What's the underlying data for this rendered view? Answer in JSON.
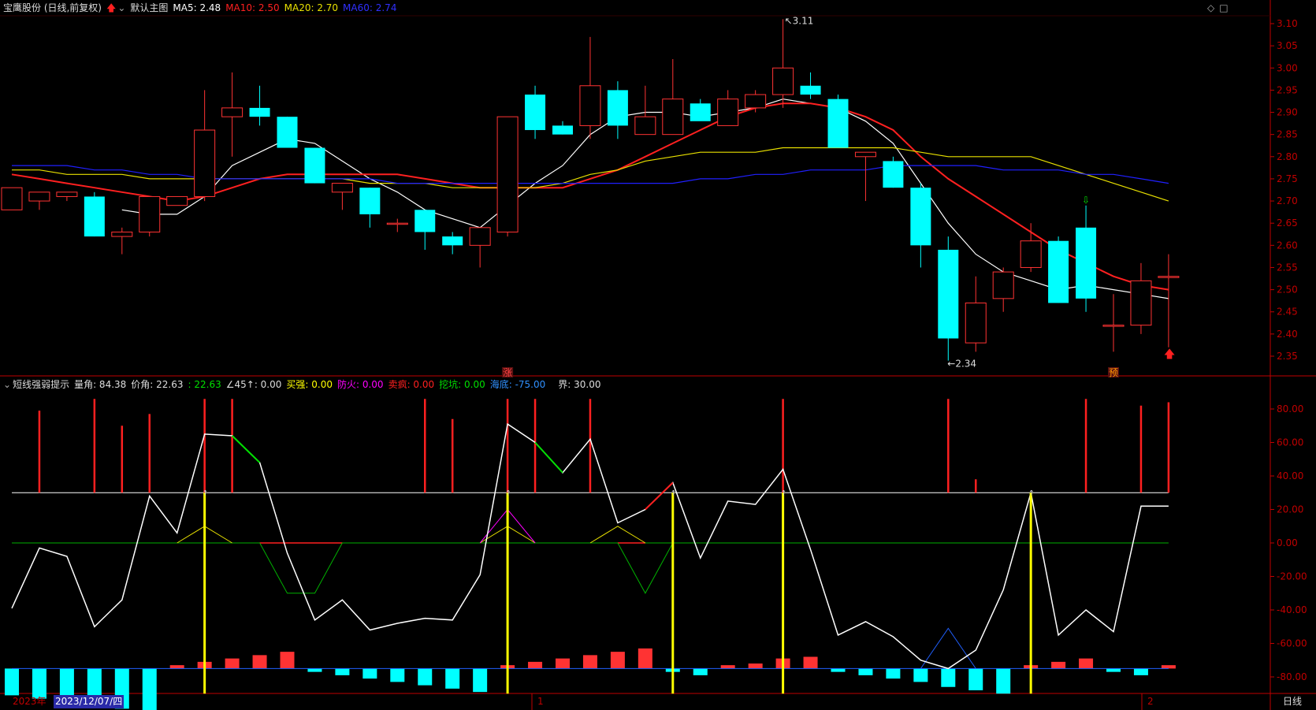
{
  "header": {
    "stock_title": "宝鹰股份 (日线,前复权)",
    "main_chart_label": "默认主图",
    "ma5_label": "MA5: 2.48",
    "ma10_label": "MA10: 2.50",
    "ma20_label": "MA20: 2.70",
    "ma60_label": "MA60: 2.74"
  },
  "indicator_header": {
    "name": "短线强弱提示",
    "vol_angle": "量角: 84.38",
    "price_angle": "价角: 22.63",
    "v1": ": 22.63",
    "v2": "∠45↑: 0.00",
    "buy_strong": "买强: 0.00",
    "fire_guard": "防火: 0.00",
    "sell_crazy": "卖疯: 0.00",
    "dig_pit": "挖坑: 0.00",
    "sea_bottom": "海底: -75.00",
    "boundary": "界: 30.00"
  },
  "footer": {
    "year_label": "2023年",
    "date_label": "2023/12/07/四",
    "month1": "1",
    "month2": "2",
    "period": "日线"
  },
  "colors": {
    "up": "#ff3333",
    "down": "#00ffff",
    "ma5": "#ffffff",
    "ma10": "#ff2020",
    "ma20": "#e8e000",
    "ma60": "#2020ff",
    "axis": "#c00000",
    "white_line": "#ffffff",
    "green": "#00b000",
    "yellow": "#ffff00",
    "magenta": "#ff00ff",
    "blue": "#2060ff"
  },
  "chart_data": [
    {
      "type": "candlestick",
      "title": "宝鹰股份 (日线,前复权)",
      "y_ticks": [
        3.1,
        3.05,
        3.0,
        2.95,
        2.9,
        2.85,
        2.8,
        2.75,
        2.7,
        2.65,
        2.6,
        2.55,
        2.5,
        2.45,
        2.4,
        2.35
      ],
      "ylim": [
        2.33,
        3.12
      ],
      "annotations": [
        {
          "text": "3.11",
          "kind": "high"
        },
        {
          "text": "2.34",
          "kind": "low"
        }
      ],
      "markers": [
        {
          "text": "涨",
          "index": 18
        },
        {
          "text": "预",
          "index": 40
        }
      ],
      "candles": [
        {
          "o": 2.68,
          "h": 2.73,
          "l": 2.68,
          "c": 2.73
        },
        {
          "o": 2.7,
          "h": 2.72,
          "l": 2.68,
          "c": 2.72
        },
        {
          "o": 2.71,
          "h": 2.72,
          "l": 2.7,
          "c": 2.72
        },
        {
          "o": 2.71,
          "h": 2.72,
          "l": 2.62,
          "c": 2.62
        },
        {
          "o": 2.62,
          "h": 2.64,
          "l": 2.58,
          "c": 2.63
        },
        {
          "o": 2.63,
          "h": 2.71,
          "l": 2.62,
          "c": 2.71
        },
        {
          "o": 2.69,
          "h": 2.71,
          "l": 2.69,
          "c": 2.71
        },
        {
          "o": 2.71,
          "h": 2.95,
          "l": 2.7,
          "c": 2.86
        },
        {
          "o": 2.89,
          "h": 2.99,
          "l": 2.8,
          "c": 2.91
        },
        {
          "o": 2.91,
          "h": 2.96,
          "l": 2.87,
          "c": 2.89
        },
        {
          "o": 2.89,
          "h": 2.89,
          "l": 2.82,
          "c": 2.82
        },
        {
          "o": 2.82,
          "h": 2.82,
          "l": 2.74,
          "c": 2.74
        },
        {
          "o": 2.72,
          "h": 2.74,
          "l": 2.68,
          "c": 2.74
        },
        {
          "o": 2.73,
          "h": 2.73,
          "l": 2.64,
          "c": 2.67
        },
        {
          "o": 2.65,
          "h": 2.66,
          "l": 2.63,
          "c": 2.65
        },
        {
          "o": 2.68,
          "h": 2.68,
          "l": 2.59,
          "c": 2.63
        },
        {
          "o": 2.62,
          "h": 2.63,
          "l": 2.58,
          "c": 2.6
        },
        {
          "o": 2.6,
          "h": 2.64,
          "l": 2.55,
          "c": 2.64
        },
        {
          "o": 2.63,
          "h": 2.89,
          "l": 2.62,
          "c": 2.89
        },
        {
          "o": 2.94,
          "h": 2.96,
          "l": 2.84,
          "c": 2.86
        },
        {
          "o": 2.87,
          "h": 2.88,
          "l": 2.85,
          "c": 2.85
        },
        {
          "o": 2.87,
          "h": 3.07,
          "l": 2.84,
          "c": 2.96
        },
        {
          "o": 2.95,
          "h": 2.97,
          "l": 2.84,
          "c": 2.87
        },
        {
          "o": 2.85,
          "h": 2.96,
          "l": 2.85,
          "c": 2.89
        },
        {
          "o": 2.85,
          "h": 3.02,
          "l": 2.85,
          "c": 2.93
        },
        {
          "o": 2.92,
          "h": 2.93,
          "l": 2.89,
          "c": 2.88
        },
        {
          "o": 2.87,
          "h": 2.95,
          "l": 2.87,
          "c": 2.93
        },
        {
          "o": 2.91,
          "h": 2.95,
          "l": 2.9,
          "c": 2.94
        },
        {
          "o": 2.94,
          "h": 3.11,
          "l": 2.91,
          "c": 3.0
        },
        {
          "o": 2.96,
          "h": 2.99,
          "l": 2.93,
          "c": 2.94
        },
        {
          "o": 2.93,
          "h": 2.94,
          "l": 2.82,
          "c": 2.82
        },
        {
          "o": 2.8,
          "h": 2.81,
          "l": 2.7,
          "c": 2.81
        },
        {
          "o": 2.79,
          "h": 2.8,
          "l": 2.73,
          "c": 2.73
        },
        {
          "o": 2.73,
          "h": 2.74,
          "l": 2.55,
          "c": 2.6
        },
        {
          "o": 2.59,
          "h": 2.62,
          "l": 2.34,
          "c": 2.39
        },
        {
          "o": 2.38,
          "h": 2.53,
          "l": 2.36,
          "c": 2.47
        },
        {
          "o": 2.48,
          "h": 2.55,
          "l": 2.45,
          "c": 2.54
        },
        {
          "o": 2.55,
          "h": 2.65,
          "l": 2.54,
          "c": 2.61
        },
        {
          "o": 2.61,
          "h": 2.62,
          "l": 2.47,
          "c": 2.47
        },
        {
          "o": 2.64,
          "h": 2.69,
          "l": 2.45,
          "c": 2.48
        },
        {
          "o": 2.42,
          "h": 2.49,
          "l": 2.36,
          "c": 2.42
        },
        {
          "o": 2.42,
          "h": 2.56,
          "l": 2.4,
          "c": 2.52
        },
        {
          "o": 2.53,
          "h": 2.58,
          "l": 2.37,
          "c": 2.53
        }
      ],
      "series": [
        {
          "name": "MA5",
          "values": [
            null,
            null,
            null,
            null,
            2.68,
            2.67,
            2.67,
            2.71,
            2.78,
            2.81,
            2.84,
            2.83,
            2.79,
            2.75,
            2.72,
            2.68,
            2.66,
            2.64,
            2.69,
            2.74,
            2.78,
            2.85,
            2.89,
            2.9,
            2.9,
            2.89,
            2.9,
            2.91,
            2.93,
            2.92,
            2.91,
            2.88,
            2.83,
            2.74,
            2.65,
            2.58,
            2.54,
            2.52,
            2.5,
            2.51,
            2.5,
            2.49,
            2.48
          ]
        },
        {
          "name": "MA10",
          "values": [
            2.76,
            2.75,
            2.74,
            2.73,
            2.72,
            2.71,
            2.7,
            2.71,
            2.73,
            2.75,
            2.76,
            2.76,
            2.76,
            2.76,
            2.76,
            2.75,
            2.74,
            2.73,
            2.73,
            2.73,
            2.73,
            2.75,
            2.77,
            2.8,
            2.83,
            2.86,
            2.89,
            2.91,
            2.92,
            2.92,
            2.91,
            2.89,
            2.86,
            2.8,
            2.75,
            2.71,
            2.67,
            2.63,
            2.59,
            2.56,
            2.53,
            2.51,
            2.5
          ]
        },
        {
          "name": "MA20",
          "values": [
            2.77,
            2.77,
            2.76,
            2.76,
            2.76,
            2.75,
            2.75,
            2.75,
            2.75,
            2.75,
            2.75,
            2.75,
            2.75,
            2.74,
            2.74,
            2.74,
            2.73,
            2.73,
            2.73,
            2.73,
            2.74,
            2.76,
            2.77,
            2.79,
            2.8,
            2.81,
            2.81,
            2.81,
            2.82,
            2.82,
            2.82,
            2.82,
            2.82,
            2.81,
            2.8,
            2.8,
            2.8,
            2.8,
            2.78,
            2.76,
            2.74,
            2.72,
            2.7
          ]
        },
        {
          "name": "MA60",
          "values": [
            2.78,
            2.78,
            2.78,
            2.77,
            2.77,
            2.76,
            2.76,
            2.75,
            2.75,
            2.75,
            2.75,
            2.75,
            2.75,
            2.75,
            2.74,
            2.74,
            2.74,
            2.74,
            2.74,
            2.74,
            2.74,
            2.74,
            2.74,
            2.74,
            2.74,
            2.75,
            2.75,
            2.76,
            2.76,
            2.77,
            2.77,
            2.77,
            2.78,
            2.78,
            2.78,
            2.78,
            2.77,
            2.77,
            2.77,
            2.76,
            2.76,
            2.75,
            2.74
          ]
        }
      ]
    },
    {
      "type": "line",
      "title": "短线强弱提示",
      "y_ticks": [
        80.0,
        60.0,
        40.0,
        20.0,
        0.0,
        -20.0,
        -40.0,
        -60.0,
        -80.0
      ],
      "ylim": [
        -100,
        90
      ],
      "boundary": 30,
      "white_line": [
        -39,
        -3,
        -8,
        -50,
        -34,
        28,
        6,
        65,
        64,
        48,
        -6,
        -46,
        -34,
        -52,
        -48,
        -45,
        -46,
        -19,
        71,
        60,
        42,
        62,
        12,
        20,
        36,
        -9,
        25,
        23,
        44,
        -4,
        -55,
        -47,
        -56,
        -70,
        -75,
        -64,
        -28,
        30,
        -55,
        -40,
        -53,
        22,
        22
      ],
      "green_segments_on_white": [
        [
          8,
          9
        ],
        [
          19,
          20
        ]
      ],
      "red_segments_on_white": [
        [
          23,
          24
        ]
      ],
      "yellow_triangle": [
        null,
        null,
        null,
        null,
        null,
        null,
        0,
        10,
        0,
        null,
        null,
        null,
        null,
        null,
        null,
        null,
        null,
        0,
        10,
        0,
        null,
        0,
        10,
        0,
        null,
        null,
        null,
        null,
        null,
        null,
        null,
        null,
        null,
        null,
        null,
        null,
        null,
        null,
        null,
        null,
        null,
        null,
        null
      ],
      "magenta_triangle": [
        null,
        null,
        null,
        null,
        null,
        null,
        null,
        null,
        null,
        null,
        null,
        null,
        null,
        null,
        null,
        null,
        null,
        0,
        20,
        0,
        null,
        null,
        null,
        null,
        null,
        null,
        null,
        null,
        null,
        null,
        null,
        null,
        null,
        null,
        null,
        null,
        null,
        null,
        null,
        null,
        null,
        null,
        null
      ],
      "green_dip": [
        null,
        null,
        null,
        null,
        null,
        null,
        null,
        null,
        null,
        0,
        -30,
        -30,
        0,
        null,
        null,
        null,
        null,
        null,
        null,
        null,
        null,
        null,
        0,
        -30,
        0,
        null,
        null,
        null,
        null,
        null,
        null,
        null,
        null,
        null,
        null,
        null,
        null,
        null,
        null,
        null,
        null,
        null,
        null
      ],
      "red_zero_segments": [
        [
          9,
          12
        ],
        [
          22,
          23
        ]
      ],
      "blue_peak": [
        null,
        null,
        null,
        null,
        null,
        null,
        null,
        null,
        null,
        null,
        null,
        null,
        null,
        null,
        null,
        null,
        null,
        null,
        null,
        null,
        null,
        null,
        null,
        null,
        null,
        null,
        null,
        null,
        null,
        null,
        null,
        null,
        null,
        -75,
        -51,
        -75,
        null,
        null,
        null,
        null,
        null,
        null,
        null
      ],
      "red_spikes_above_boundary": [
        0,
        1,
        0,
        2,
        4,
        5,
        0,
        0,
        8,
        0,
        0,
        0,
        0,
        0,
        0,
        0,
        0,
        0,
        0,
        0,
        0,
        0,
        0,
        0,
        0,
        0,
        0,
        0,
        0,
        0,
        0,
        0,
        0,
        0,
        0,
        0,
        0,
        0,
        0,
        0,
        0,
        0,
        0
      ],
      "red_spike_indices": [
        1,
        3,
        4,
        5,
        7,
        8,
        15,
        16,
        18,
        19,
        21,
        28,
        34,
        35,
        39,
        41,
        42
      ],
      "red_spike_tops": [
        79,
        86,
        70,
        77,
        86,
        86,
        86,
        74,
        86,
        86,
        86,
        86,
        86,
        38,
        86,
        82,
        84
      ],
      "yellow_signal_indices": [
        7,
        18,
        24,
        28,
        37
      ],
      "histogram": [
        -91,
        -93,
        -95,
        -98,
        -99,
        -100,
        -73,
        -71,
        -69,
        -67,
        -65,
        -77,
        -79,
        -81,
        -83,
        -85,
        -87,
        -89,
        -73,
        -71,
        -69,
        -67,
        -65,
        -63,
        -77,
        -79,
        -73,
        -72,
        -69,
        -68,
        -77,
        -79,
        -81,
        -83,
        -86,
        -88,
        -90,
        -73,
        -71,
        -69,
        -77,
        -79,
        -73
      ]
    }
  ]
}
